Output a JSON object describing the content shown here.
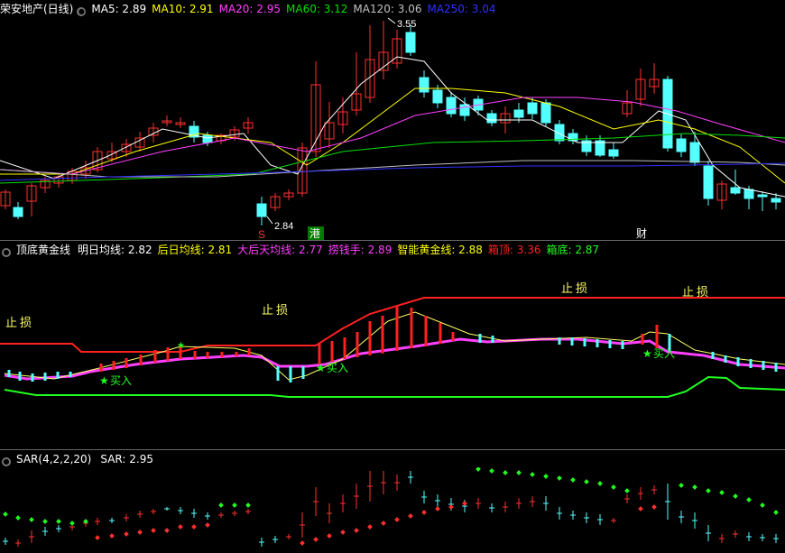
{
  "colors": {
    "bg": "#000000",
    "up": "#ff3030",
    "down": "#54ffff",
    "ma5": "#ffffff",
    "ma10": "#ffff00",
    "ma20": "#ff40ff",
    "ma60": "#00e000",
    "ma120": "#c0c0c0",
    "ma250": "#3030ff"
  },
  "panel1": {
    "title": "荣安地产(日线)",
    "ma": [
      {
        "label": "MA5: 2.89",
        "color": "#ffffff"
      },
      {
        "label": "MA10: 2.91",
        "color": "#ffff00"
      },
      {
        "label": "MA20: 2.95",
        "color": "#ff40ff"
      },
      {
        "label": "MA60: 3.12",
        "color": "#00e000"
      },
      {
        "label": "MA120: 3.06",
        "color": "#c0c0c0"
      },
      {
        "label": "MA250: 3.04",
        "color": "#3030ff"
      }
    ],
    "high_label": "3.55",
    "low_label": "2.84",
    "marks": {
      "s": "S",
      "gang": "港",
      "cai": "财"
    }
  },
  "panel2": {
    "title": "顶底黄金线",
    "items": [
      {
        "label": "明日均线: 2.82",
        "color": "#ffffff"
      },
      {
        "label": "后日均线: 2.81",
        "color": "#ffff00"
      },
      {
        "label": "大后天均线: 2.77",
        "color": "#ff40ff"
      },
      {
        "label": "捞钱手: 2.89",
        "color": "#ff40ff"
      },
      {
        "label": "智能黄金线: 2.88",
        "color": "#ffff00"
      },
      {
        "label": "箱顶: 3.36",
        "color": "#ff2020"
      },
      {
        "label": "箱底: 2.87",
        "color": "#20ff20"
      }
    ],
    "stop_label": "止损",
    "buy_label": "买入",
    "star": "★"
  },
  "panel3": {
    "title": "SAR(4,2,2,20)",
    "value": "SAR: 2.95"
  }
}
